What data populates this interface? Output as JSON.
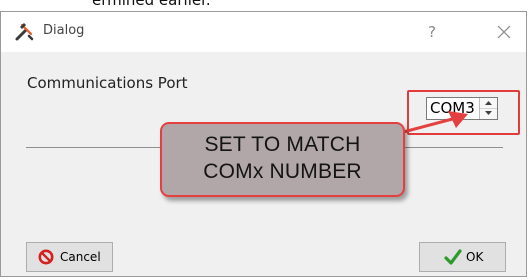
{
  "caption": {
    "text": "ermined earlier."
  },
  "dialog": {
    "title": "Dialog",
    "help_glyph": "?",
    "close_icon": "close-icon",
    "title_icon": "tools-icon",
    "port_label": "Communications Port",
    "port_value": "COM3",
    "cancel_label": "Cancel",
    "cancel_icon": "no-entry-icon",
    "ok_label": "OK",
    "ok_icon": "checkmark-icon"
  },
  "annotation": {
    "line1": "SET TO MATCH",
    "line2": "COMx NUMBER",
    "fill_color": "#b1a6a8",
    "border_color": "#e54040"
  }
}
